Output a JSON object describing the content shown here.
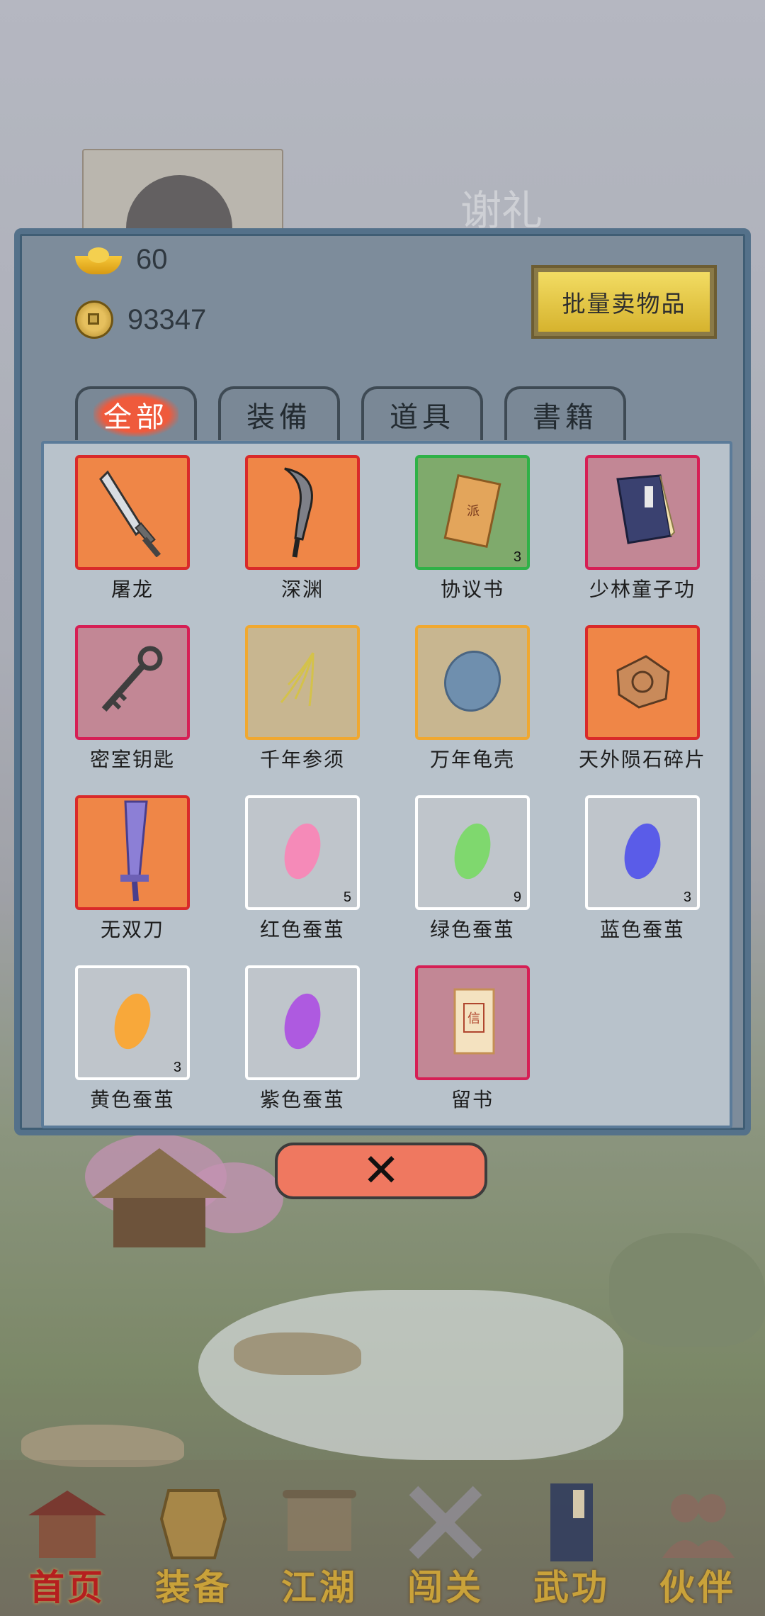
{
  "background": {
    "sign_text": "谢礼"
  },
  "currency": {
    "gold": "60",
    "coins": "93347"
  },
  "sell_button_label": "批量卖物品",
  "tabs": [
    {
      "label": "全部",
      "active": true
    },
    {
      "label": "装備",
      "active": false
    },
    {
      "label": "道具",
      "active": false
    },
    {
      "label": "書籍",
      "active": false
    }
  ],
  "items": [
    {
      "name": "屠龙",
      "rarity": "orange",
      "icon": "broad-sword-icon",
      "count": ""
    },
    {
      "name": "深渊",
      "rarity": "orange",
      "icon": "curved-blade-icon",
      "count": ""
    },
    {
      "name": "协议书",
      "rarity": "green",
      "icon": "document-icon",
      "count": "3"
    },
    {
      "name": "少林童子功",
      "rarity": "pink",
      "icon": "book-icon",
      "count": ""
    },
    {
      "name": "密室钥匙",
      "rarity": "pink",
      "icon": "key-icon",
      "count": ""
    },
    {
      "name": "千年参须",
      "rarity": "gold",
      "icon": "ginseng-icon",
      "count": ""
    },
    {
      "name": "万年龟壳",
      "rarity": "gold",
      "icon": "turtle-shell-icon",
      "count": ""
    },
    {
      "name": "天外陨石碎片",
      "rarity": "orange",
      "icon": "meteorite-icon",
      "count": ""
    },
    {
      "name": "无双刀",
      "rarity": "orange",
      "icon": "purple-blade-icon",
      "count": ""
    },
    {
      "name": "红色蚕茧",
      "rarity": "white",
      "icon": "red-cocoon-icon",
      "count": "5"
    },
    {
      "name": "绿色蚕茧",
      "rarity": "white",
      "icon": "green-cocoon-icon",
      "count": "9"
    },
    {
      "name": "蓝色蚕茧",
      "rarity": "white",
      "icon": "blue-cocoon-icon",
      "count": "3"
    },
    {
      "name": "黄色蚕茧",
      "rarity": "white",
      "icon": "yellow-cocoon-icon",
      "count": "3"
    },
    {
      "name": "紫色蚕茧",
      "rarity": "white",
      "icon": "purple-cocoon-icon",
      "count": ""
    },
    {
      "name": "留书",
      "rarity": "pink",
      "icon": "letter-icon",
      "count": ""
    }
  ],
  "close_button_glyph": "✕",
  "bottom_nav": [
    {
      "label": "首页",
      "icon": "house-icon",
      "active": true
    },
    {
      "label": "装备",
      "icon": "armor-icon",
      "active": false
    },
    {
      "label": "江湖",
      "icon": "scroll-icon",
      "active": false
    },
    {
      "label": "闯关",
      "icon": "crossed-swords-icon",
      "active": false
    },
    {
      "label": "武功",
      "icon": "martial-book-icon",
      "active": false
    },
    {
      "label": "伙伴",
      "icon": "companions-icon",
      "active": false
    }
  ],
  "colors": {
    "orange_rarity": "#ef8647",
    "green_rarity": "#2fb147",
    "pink_rarity": "#d61f55",
    "gold_rarity": "#f0a830",
    "white_rarity": "#ffffff",
    "nav_label": "#c9a23a",
    "nav_active": "#b51f1f"
  }
}
